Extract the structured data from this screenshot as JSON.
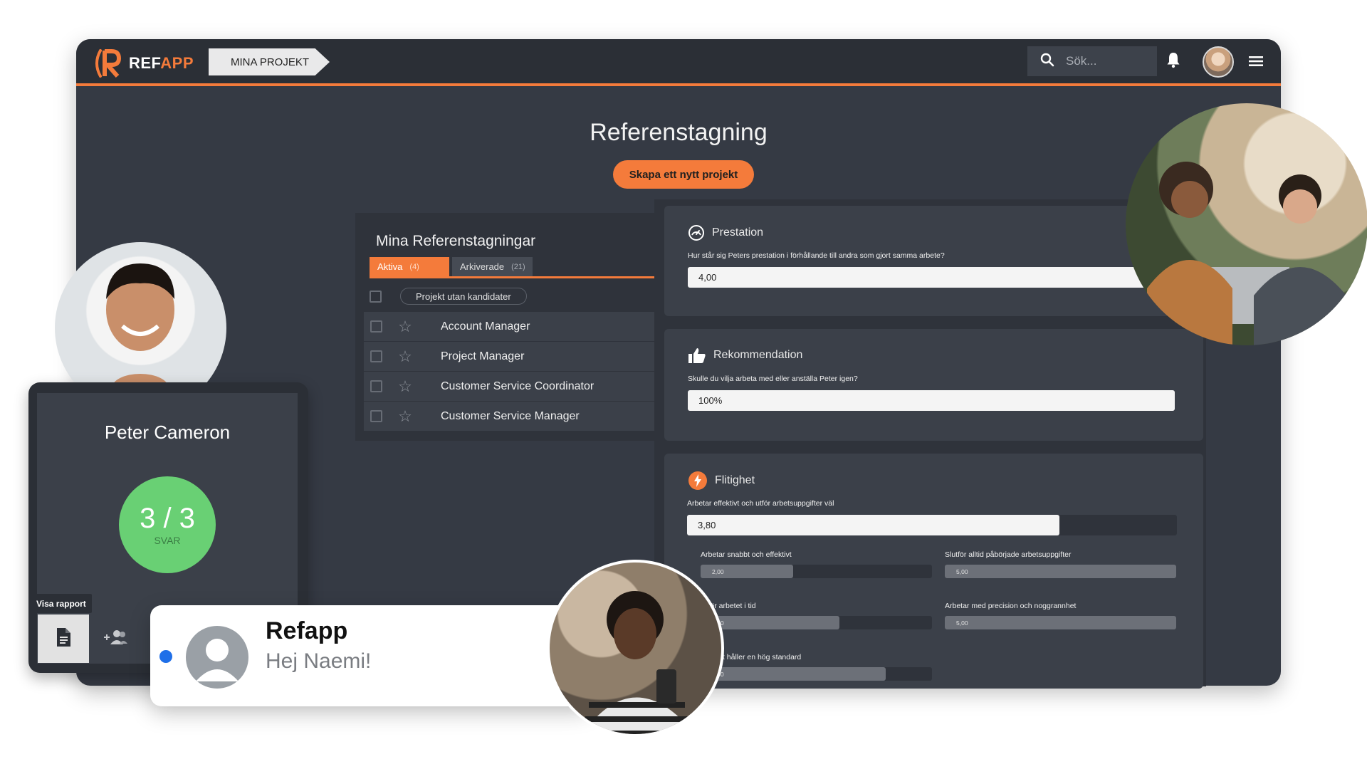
{
  "app": {
    "logo_text_main": "REF",
    "logo_text_accent": "APP",
    "breadcrumb": "MINA PROJEKT",
    "search_placeholder": "Sök..."
  },
  "page": {
    "title": "Referenstagning",
    "new_project_button": "Skapa ett nytt projekt"
  },
  "list": {
    "title": "Mina Referenstagningar",
    "tabs": [
      {
        "label": "Aktiva",
        "count": "(4)"
      },
      {
        "label": "Arkiverade",
        "count": "(21)"
      }
    ],
    "filter_chip": "Projekt utan kandidater",
    "items": [
      {
        "label": "Account Manager"
      },
      {
        "label": "Project Manager"
      },
      {
        "label": "Customer Service Coordinator"
      },
      {
        "label": "Customer Service Manager"
      }
    ]
  },
  "cards": {
    "prestation": {
      "title": "Prestation",
      "question": "Hur står sig Peters prestation i förhållande till andra som gjort samma arbete?",
      "value": "4,00"
    },
    "rekommendation": {
      "title": "Rekommendation",
      "question": "Skulle du vilja arbeta med eller anställa Peter igen?",
      "value": "100%"
    },
    "flitighet": {
      "title": "Flitighet",
      "question": "Arbetar effektivt och utför arbetsuppgifter väl",
      "value": "3,80",
      "fraction": 0.76,
      "sub": [
        {
          "label": "Arbetar snabbt och effektivt",
          "value": "2,00",
          "fraction": 0.4
        },
        {
          "label": "Slutför alltid påbörjade arbetsuppgifter",
          "value": "5,00",
          "fraction": 1.0
        },
        {
          "label": "Utför arbetet i tid",
          "value": "3,00",
          "fraction": 0.6
        },
        {
          "label": "Arbetar med precision och noggrannhet",
          "value": "5,00",
          "fraction": 1.0
        },
        {
          "label": "Arbetet håller en hög standard",
          "value": "4,00",
          "fraction": 0.8
        }
      ]
    }
  },
  "candidate": {
    "name": "Peter Cameron",
    "score": "3 / 3",
    "score_label": "SVAR",
    "tooltip": "Visa rapport"
  },
  "notification": {
    "title": "Refapp",
    "message": "Hej Naemi!"
  },
  "colors": {
    "accent": "#f47b3b",
    "success": "#69d074",
    "notif_dot": "#1f6fe8"
  }
}
